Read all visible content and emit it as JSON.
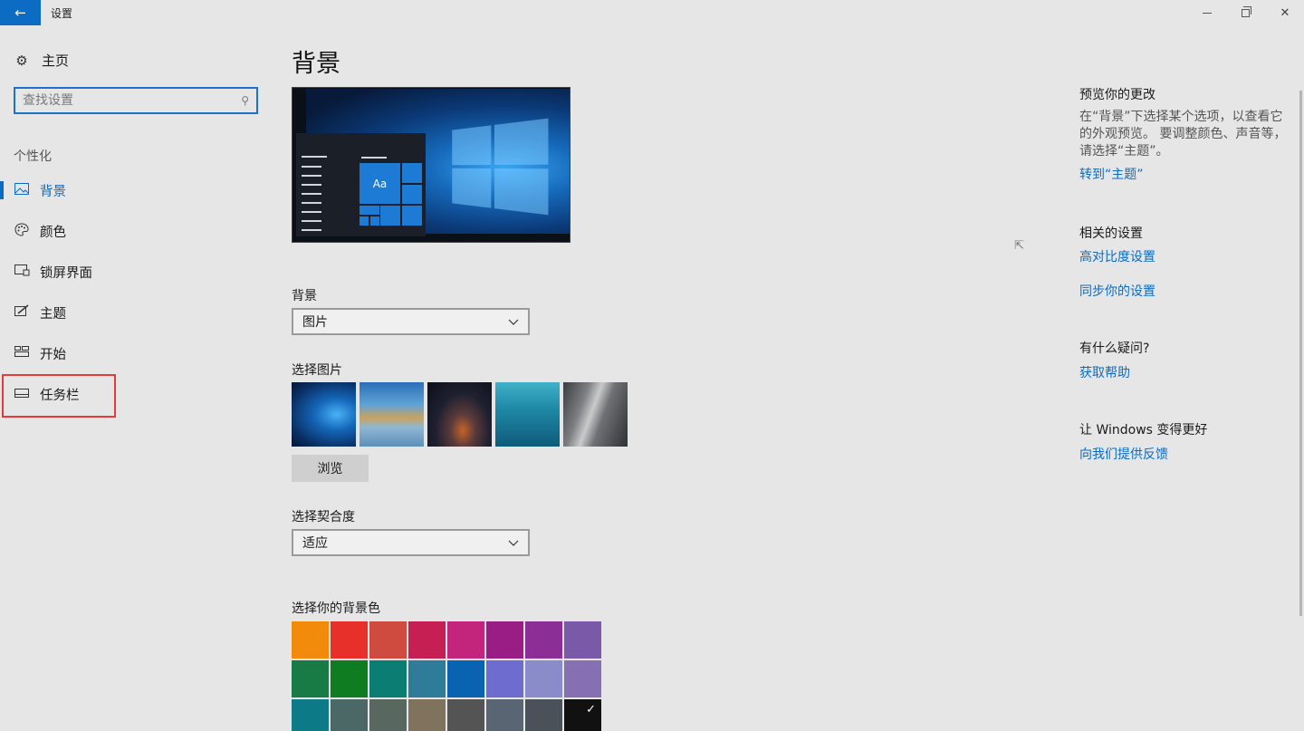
{
  "window": {
    "title": "设置",
    "back_glyph": "←",
    "close_glyph": "✕"
  },
  "sidebar": {
    "home_label": "主页",
    "search_placeholder": "查找设置",
    "section_label": "个性化",
    "items": [
      {
        "label": "背景",
        "icon": "picture-icon",
        "active": true
      },
      {
        "label": "颜色",
        "icon": "palette-icon",
        "active": false
      },
      {
        "label": "锁屏界面",
        "icon": "lock-screen-icon",
        "active": false
      },
      {
        "label": "主题",
        "icon": "theme-brush-icon",
        "active": false
      },
      {
        "label": "开始",
        "icon": "start-tiles-icon",
        "active": false
      },
      {
        "label": "任务栏",
        "icon": "taskbar-icon",
        "active": false,
        "highlighted": true
      }
    ]
  },
  "main": {
    "title": "背景",
    "preview_tile_text": "Aa",
    "background_label": "背景",
    "background_value": "图片",
    "choose_picture_label": "选择图片",
    "browse_label": "浏览",
    "fit_label": "选择契合度",
    "fit_value": "适应",
    "color_label": "选择你的背景色",
    "colors": [
      "#f28b0c",
      "#e8302a",
      "#cf4a3f",
      "#c51f54",
      "#c3257c",
      "#9a1d86",
      "#8b2f97",
      "#7a5aa8",
      "#187a44",
      "#107c22",
      "#0c7d73",
      "#2e7c9a",
      "#0a63b1",
      "#6e6cce",
      "#8a8cca",
      "#8670b2",
      "#0c7a87",
      "#4b6866",
      "#586860",
      "#7f735e",
      "#545454",
      "#596573",
      "#4b5158",
      "#111111"
    ],
    "selected_color_index": 23
  },
  "right_panel": {
    "preview_heading": "预览你的更改",
    "preview_text": "在“背景”下选择某个选项，以查看它的外观预览。 要调整颜色、声音等，请选择“主题”。",
    "goto_theme_link": "转到“主题”",
    "related_heading": "相关的设置",
    "high_contrast_link": "高对比度设置",
    "sync_link": "同步你的设置",
    "question_heading": "有什么疑问?",
    "help_link": "获取帮助",
    "feedback_heading": "让 Windows 变得更好",
    "feedback_link": "向我们提供反馈"
  }
}
